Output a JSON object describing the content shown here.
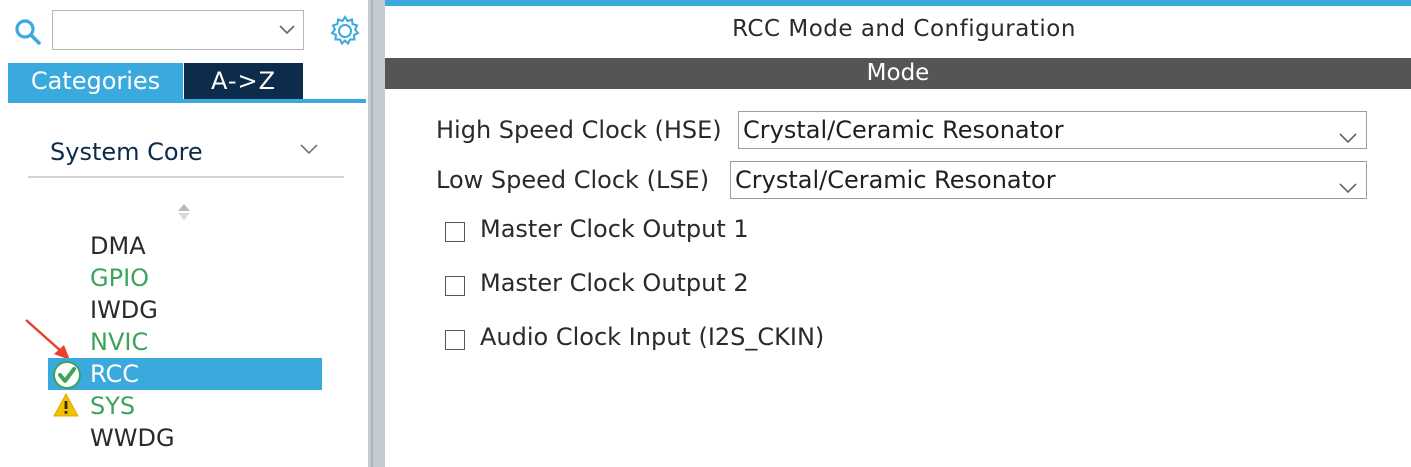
{
  "left_panel": {
    "search": {
      "value": "",
      "placeholder": ""
    },
    "tabs": [
      {
        "label": "Categories",
        "active": true
      },
      {
        "label": "A->Z",
        "active": false
      }
    ],
    "category": {
      "selected": "System Core"
    },
    "items": [
      {
        "label": "DMA",
        "status": "none",
        "color": "dark"
      },
      {
        "label": "GPIO",
        "status": "none",
        "color": "green"
      },
      {
        "label": "IWDG",
        "status": "none",
        "color": "dark"
      },
      {
        "label": "NVIC",
        "status": "none",
        "color": "green"
      },
      {
        "label": "RCC",
        "status": "check",
        "selected": true
      },
      {
        "label": "SYS",
        "status": "warning",
        "color": "green"
      },
      {
        "label": "WWDG",
        "status": "none",
        "color": "dark"
      }
    ]
  },
  "right_panel": {
    "title": "RCC Mode and Configuration",
    "section": "Mode",
    "hse": {
      "label": "High Speed Clock (HSE)",
      "value": "Crystal/Ceramic Resonator"
    },
    "lse": {
      "label": "Low Speed Clock (LSE)",
      "value": "Crystal/Ceramic Resonator"
    },
    "checkboxes": [
      {
        "label": "Master Clock Output 1",
        "checked": false
      },
      {
        "label": "Master Clock Output 2",
        "checked": false
      },
      {
        "label": "Audio Clock Input (I2S_CKIN)",
        "checked": false
      }
    ]
  },
  "colors": {
    "accent": "#3aa9dd",
    "dark_tab": "#0d2b4a",
    "mode_bar": "#555555",
    "green": "#3aa45a",
    "warning": "#f2c200",
    "arrow": "#e8402a"
  }
}
